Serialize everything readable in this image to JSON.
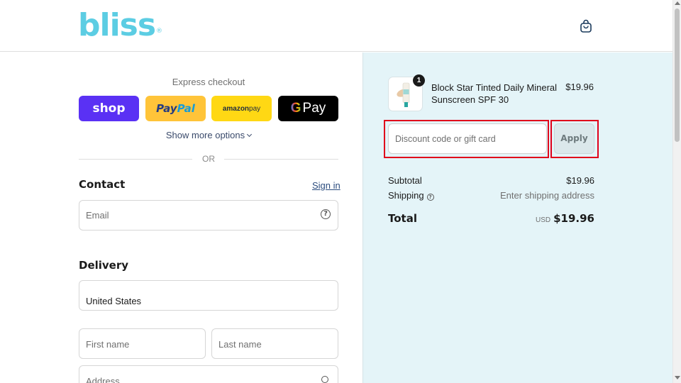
{
  "brand": {
    "logo_text": "bliss",
    "logo_mark": "®",
    "accent_color": "#5ccde3"
  },
  "header": {
    "cart_icon": "shopping-bag-icon"
  },
  "express": {
    "title": "Express checkout",
    "buttons": {
      "shop": "shop",
      "paypal_pay": "Pay",
      "paypal_pal": "Pal",
      "amazon_brand": "amazon",
      "amazon_pay": " pay",
      "gpay_g": "G",
      "gpay_pay": "Pay"
    },
    "show_more": "Show more options",
    "or": "OR"
  },
  "contact": {
    "title": "Contact",
    "sign_in": "Sign in",
    "email_placeholder": "Email"
  },
  "delivery": {
    "title": "Delivery",
    "country": "United States",
    "first_name_placeholder": "First name",
    "last_name_placeholder": "Last name",
    "address_placeholder": "Address"
  },
  "summary": {
    "product": {
      "name": "Block Star Tinted Daily Mineral Sunscreen SPF 30",
      "price": "$19.96",
      "quantity": "1"
    },
    "discount_placeholder": "Discount code or gift card",
    "apply_label": "Apply",
    "subtotal_label": "Subtotal",
    "subtotal_value": "$19.96",
    "shipping_label": "Shipping",
    "shipping_value": "Enter shipping address",
    "total_label": "Total",
    "currency": "USD",
    "total_value": "$19.96",
    "panel_color": "#e4f4f8",
    "highlight_color": "#e0001b"
  }
}
